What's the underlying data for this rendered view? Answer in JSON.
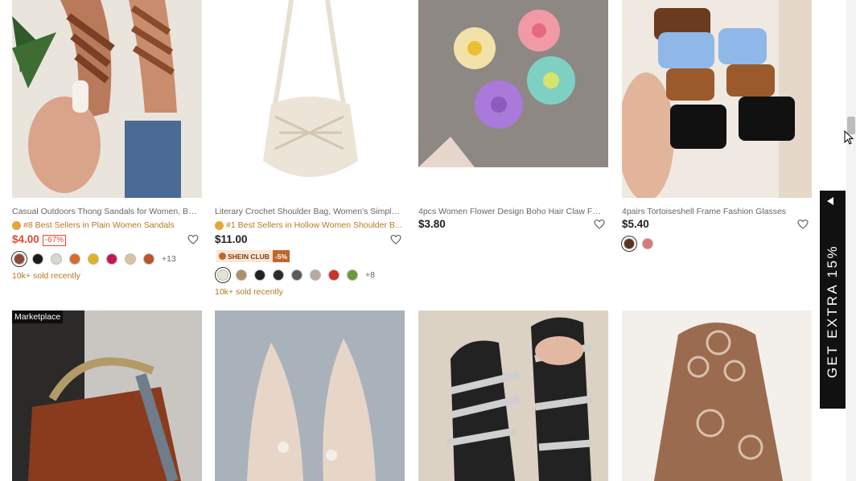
{
  "products_row1": [
    {
      "title": "Casual Outdoors Thong Sandals for Women, Brai...",
      "rank": "#8 Best Sellers in Plain Women Sandals",
      "price": "$4.00",
      "discount": "-67%",
      "swatch_colors": [
        "#8b4a33",
        "#1b1b1b",
        "#d9d6d0",
        "#d9692e",
        "#e0b323",
        "#c2184f",
        "#d8c4a3",
        "#b8562c"
      ],
      "more_colors": "+13",
      "sold": "10k+ sold recently"
    },
    {
      "title": "Literary Crochet Shoulder Bag, Women's Simple ...",
      "rank": "#1 Best Sellers in Hollow Women Shoulder B...",
      "price": "$11.00",
      "club_label": "SHEIN CLUB",
      "club_discount": "-5%",
      "swatch_colors": [
        "#e8e2d6",
        "#a8926c",
        "#222222",
        "#2b2b2b",
        "#5a5a5a",
        "#b5aba0",
        "#c9332c",
        "#6a9a3a"
      ],
      "more_colors": "+8",
      "sold": "10k+ sold recently"
    },
    {
      "title": "4pcs Women Flower Design Boho Hair Claw For ...",
      "price": "$3.80"
    },
    {
      "title": "4pairs Tortoiseshell Frame Fashion Glasses",
      "price": "$5.40",
      "swatch_colors": [
        "#5a3220",
        "#d87a7a"
      ]
    }
  ],
  "products_row2": [
    {
      "badge": "Marketplace"
    },
    {},
    {},
    {}
  ],
  "promo": {
    "text": "GET EXTRA 15%"
  },
  "colors": {
    "sale_red": "#e04a2f",
    "rank_gold": "#b37a1e",
    "club_brown": "#c0662b"
  }
}
